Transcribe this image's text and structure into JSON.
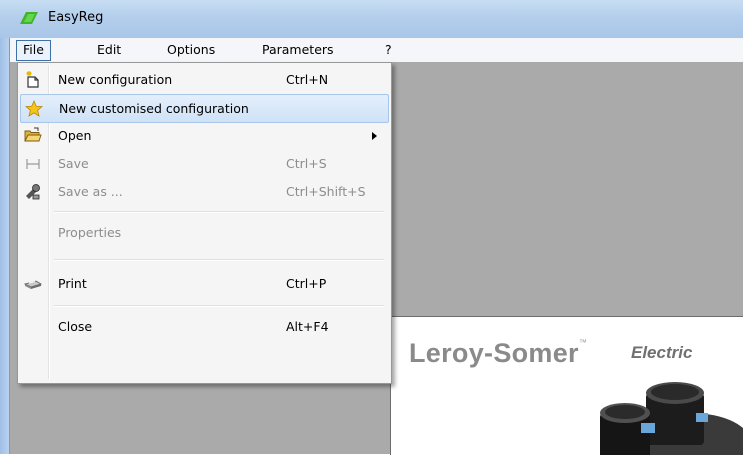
{
  "window": {
    "title": "EasyReg",
    "app_icon": "easyreg-logo-icon"
  },
  "menubar": {
    "items": [
      {
        "label": "File",
        "active": true
      },
      {
        "label": "Edit"
      },
      {
        "label": "Options"
      },
      {
        "label": "Parameters"
      },
      {
        "label": "?"
      }
    ]
  },
  "file_menu": {
    "items": [
      {
        "label": "New configuration",
        "shortcut": "Ctrl+N",
        "icon": "new-file-icon",
        "enabled": true
      },
      {
        "label": "New customised configuration",
        "shortcut": "",
        "icon": "star-icon",
        "enabled": true,
        "highlighted": true
      },
      {
        "label": "Open",
        "shortcut": "",
        "icon": "open-folder-icon",
        "enabled": true,
        "submenu": true
      },
      {
        "label": "Save",
        "shortcut": "Ctrl+S",
        "icon": "save-icon",
        "enabled": false
      },
      {
        "label": "Save as ...",
        "shortcut": "Ctrl+Shift+S",
        "icon": "save-as-icon",
        "enabled": false
      },
      {
        "label": "Properties",
        "shortcut": "",
        "icon": "",
        "enabled": false
      },
      {
        "label": "Print",
        "shortcut": "Ctrl+P",
        "icon": "printer-icon",
        "enabled": true
      },
      {
        "label": "Close",
        "shortcut": "Alt+F4",
        "icon": "",
        "enabled": true
      }
    ]
  },
  "document": {
    "brand": "Leroy-Somer",
    "brand_tagline": "Electric"
  },
  "colors": {
    "title_bar": "#b4cfec",
    "menu_highlight": "#cfe2f7",
    "client_background": "#aaaaaa"
  }
}
